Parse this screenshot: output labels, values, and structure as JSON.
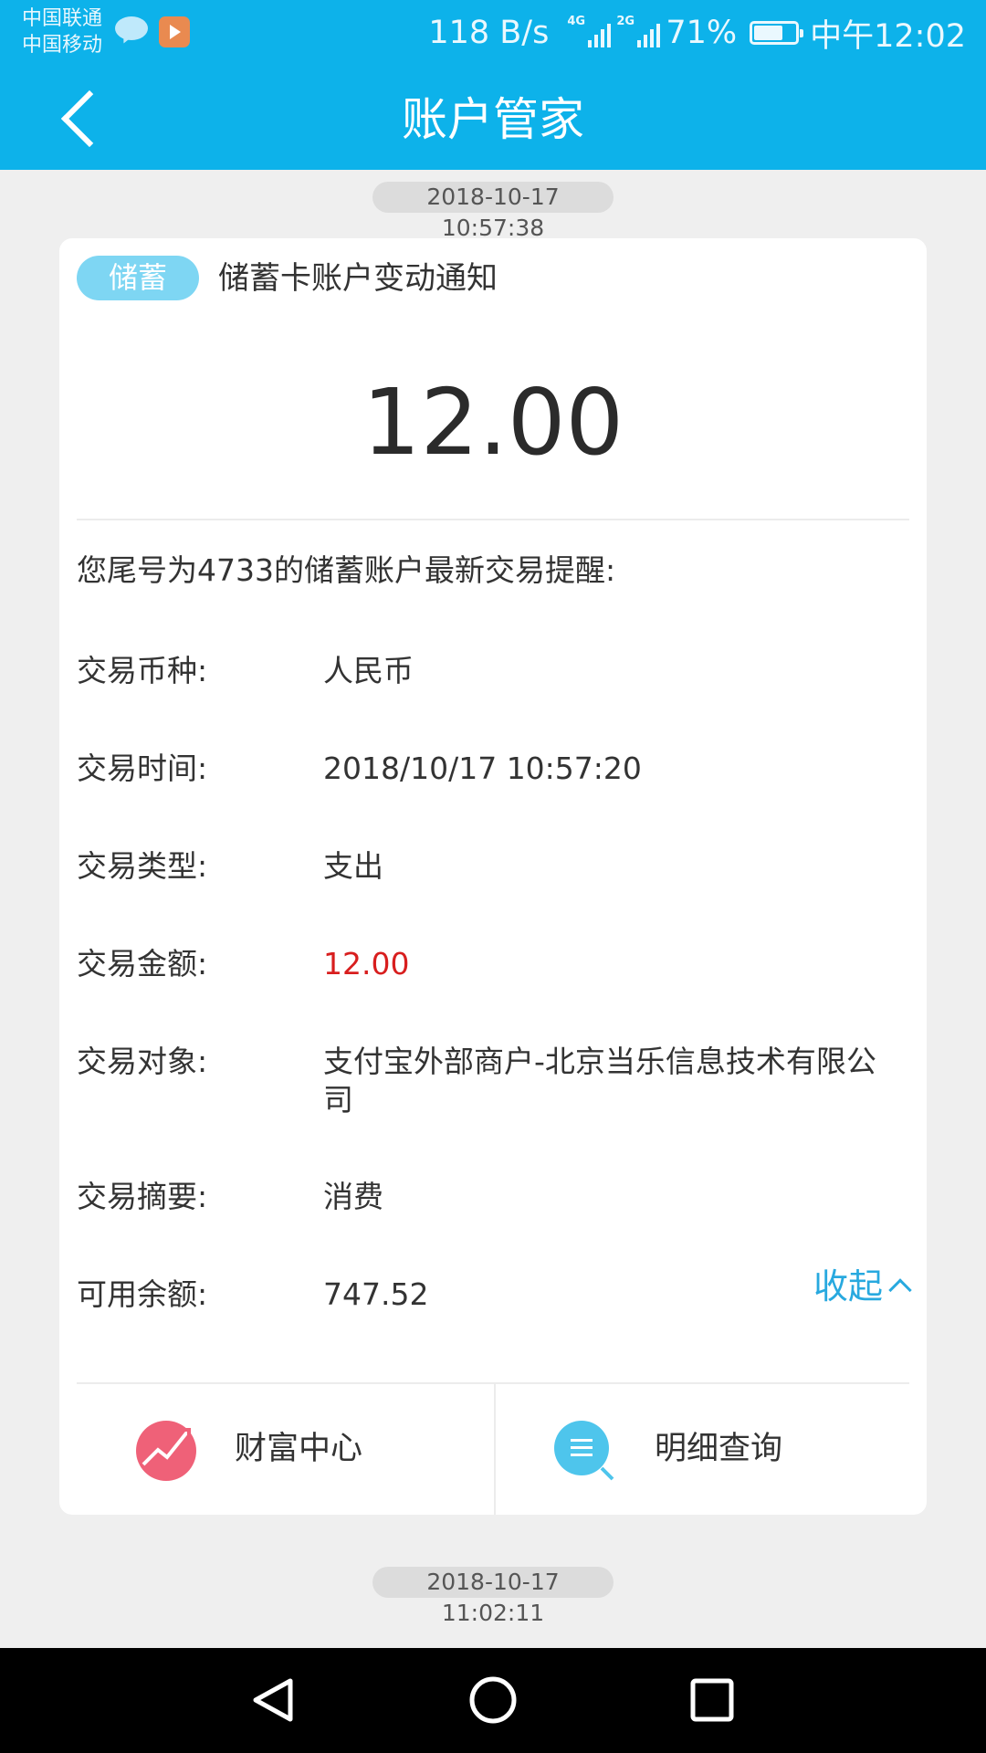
{
  "status_bar": {
    "carrier_1": "中国联通",
    "carrier_2": "中国移动",
    "net_speed": "118 B/s",
    "signal_1_tag": "4G",
    "signal_2_tag": "2G",
    "battery_percent_text": "71%",
    "battery_level": 0.71,
    "time": "中午12:02"
  },
  "header": {
    "title": "账户管家"
  },
  "messages": [
    {
      "timestamp": "2018-10-17 10:57:38",
      "badge": "储蓄",
      "title": "储蓄卡账户变动通知",
      "amount": "12.00",
      "intro": "您尾号为4733的储蓄账户最新交易提醒:",
      "rows": [
        {
          "key": "交易币种:",
          "value": "人民币"
        },
        {
          "key": "交易时间:",
          "value": "2018/10/17 10:57:20"
        },
        {
          "key": "交易类型:",
          "value": "支出"
        },
        {
          "key": "交易金额:",
          "value": "12.00"
        },
        {
          "key": "交易对象:",
          "value": "支付宝外部商户-北京当乐信息技术有限公司"
        },
        {
          "key": "交易摘要:",
          "value": "消费"
        },
        {
          "key": "可用余额:",
          "value": "747.52"
        }
      ],
      "collapse_label": "收起",
      "actions": {
        "wealth_label": "财富中心",
        "detail_label": "明细查询"
      }
    },
    {
      "timestamp": "2018-10-17 11:02:11"
    }
  ],
  "colors": {
    "accent": "#0db2ea",
    "amount_red": "#d81e1e",
    "link_blue": "#28a9df",
    "wealth_icon": "#ef6178",
    "query_icon": "#4ec5ec"
  }
}
